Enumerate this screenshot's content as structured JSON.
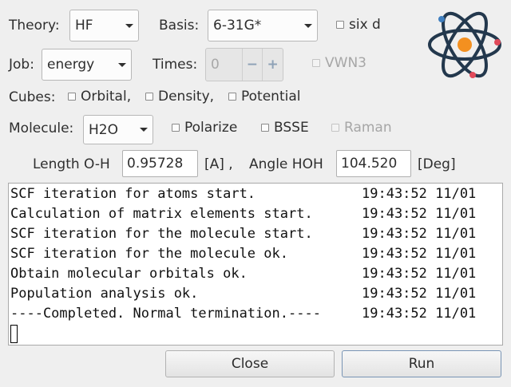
{
  "theory": {
    "label": "Theory:",
    "value": "HF"
  },
  "basis": {
    "label": "Basis:",
    "value": "6-31G*"
  },
  "six_d": {
    "label": "six d",
    "checked": false
  },
  "job": {
    "label": "Job:",
    "value": "energy"
  },
  "times": {
    "label": "Times:",
    "value": "0",
    "minus": "−",
    "plus": "+"
  },
  "vwn3": {
    "label": "VWN3",
    "enabled": false
  },
  "cubes": {
    "label": "Cubes:",
    "orbital": "Orbital,",
    "density": "Density,",
    "potential": "Potential"
  },
  "molecule": {
    "label": "Molecule:",
    "value": "H2O"
  },
  "polarize": {
    "label": "Polarize"
  },
  "bsse": {
    "label": "BSSE"
  },
  "raman": {
    "label": "Raman",
    "enabled": false
  },
  "length": {
    "label": "Length O-H",
    "value": "0.95728",
    "unit": "[A] ,"
  },
  "angle": {
    "label": "Angle HOH",
    "value": "104.520",
    "unit": "[Deg]"
  },
  "log": {
    "lines": [
      {
        "text": "SCF iteration for atoms start.",
        "time": "19:43:52 11/01"
      },
      {
        "text": "Calculation of matrix elements start.",
        "time": "19:43:52 11/01"
      },
      {
        "text": "SCF iteration for the molecule start.",
        "time": "19:43:52 11/01"
      },
      {
        "text": "SCF iteration for the molecule ok.",
        "time": "19:43:52 11/01"
      },
      {
        "text": "Obtain molecular orbitals ok.",
        "time": "19:43:52 11/01"
      },
      {
        "text": "Population analysis ok.",
        "time": "19:43:52 11/01"
      },
      {
        "text": "----Completed. Normal termination.----",
        "time": "19:43:52 11/01"
      }
    ]
  },
  "buttons": {
    "close": "Close",
    "run": "Run"
  },
  "logo": {
    "icon": "atom-icon",
    "nucleus_color": "#f39020",
    "orbit_color": "#23384d",
    "electron_color": "#e04a5a",
    "electron_alt_color": "#3f7fc0"
  }
}
